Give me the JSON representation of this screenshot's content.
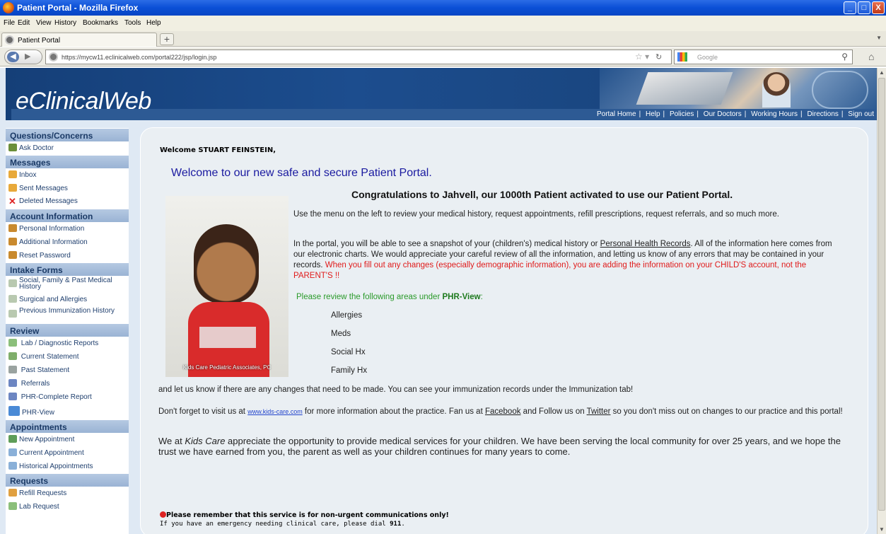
{
  "browser": {
    "title": "Patient Portal - Mozilla Firefox",
    "menu": [
      "File",
      "Edit",
      "View",
      "History",
      "Bookmarks",
      "Tools",
      "Help"
    ],
    "tab_title": "Patient Portal",
    "new_tab": "+",
    "url": "https://mycw11.eclinicalweb.com/portal222/jsp/login.jsp",
    "search_placeholder": "Google",
    "min": "_",
    "max": "□",
    "close": "X"
  },
  "header": {
    "logo": "eClinicalWeb",
    "nav": [
      "Portal Home",
      "Help",
      "Policies",
      "Our Doctors",
      "Working Hours",
      "Directions",
      "Sign out"
    ]
  },
  "sidebar": [
    {
      "heading": "Questions/Concerns",
      "items": [
        {
          "label": "Ask Doctor",
          "icon": "doctor-icon"
        }
      ]
    },
    {
      "heading": "Messages",
      "items": [
        {
          "label": "Inbox",
          "icon": "envelope-icon"
        },
        {
          "label": "Sent Messages",
          "icon": "envelope-icon"
        },
        {
          "label": "Deleted Messages",
          "icon": "delete-icon"
        }
      ]
    },
    {
      "heading": "Account Information",
      "items": [
        {
          "label": "Personal Information",
          "icon": "users-icon"
        },
        {
          "label": "Additional Information",
          "icon": "users-icon"
        },
        {
          "label": "Reset Password",
          "icon": "users-icon"
        }
      ]
    },
    {
      "heading": "Intake Forms",
      "items": [
        {
          "label": "Social, Family & Past Medical History",
          "icon": "folder-icon"
        },
        {
          "label": "Surgical and Allergies",
          "icon": "folder-icon"
        },
        {
          "label": "Previous Immunization History",
          "icon": "folder-icon"
        }
      ]
    },
    {
      "heading": "Review",
      "items": [
        {
          "label": "Lab / Diagnostic Reports",
          "icon": "lab-icon"
        },
        {
          "label": "Current Statement",
          "icon": "statement-icon"
        },
        {
          "label": "Past Statement",
          "icon": "statement-icon"
        },
        {
          "label": "Referrals",
          "icon": "referral-icon"
        },
        {
          "label": "PHR-Complete Report",
          "icon": "report-icon"
        },
        {
          "label": "PHR-View",
          "icon": "phr-view-icon"
        }
      ]
    },
    {
      "heading": "Appointments",
      "items": [
        {
          "label": "New Appointment",
          "icon": "calendar-icon"
        },
        {
          "label": "Current Appointment",
          "icon": "calendar-icon"
        },
        {
          "label": "Historical Appointments",
          "icon": "calendar-icon"
        }
      ]
    },
    {
      "heading": "Requests",
      "items": [
        {
          "label": "Refill Requests",
          "icon": "refill-icon"
        },
        {
          "label": "Lab Request",
          "icon": "lab-icon"
        }
      ]
    }
  ],
  "content": {
    "welcome": "Welcome STUART FEINSTEIN,",
    "headline": "Welcome to our new safe and secure Patient Portal.",
    "congrats": "Congratulations to Jahvell,  our 1000th Patient activated to use our Patient Portal.",
    "photo_caption": "Kids Care Pediatric Associates, PC",
    "para1": "Use the  menu on the left to review your medical history, request appointments, refill prescriptions, request referrals, and so much more.",
    "para2a": "In the portal, you will be able to see a snapshot of your (children's) medical history or ",
    "para2_link": "Personal Health Records",
    "para2b": ".  All of the information here comes from our electronic charts.  We would appreciate your careful review of all the information, and letting us know of any errors that may be contained in your records. ",
    "para2_red": "When you fill out any changes (especially demographic information), you are adding the information on your CHILD'S account,  not the PARENT'S !!",
    "review_intro": "Please review the following areas under ",
    "review_bold": "PHR-View",
    "review_colon": ":",
    "areas": [
      "Allergies",
      "Meds",
      "Social Hx",
      "Family Hx"
    ],
    "para3": "and let us know if there are any changes that need to be made.  You can see your immunization records under the Immunization tab!",
    "para4a": "Don't forget to visit us at ",
    "para4_link": "www.kids-care.com",
    "para4b": " for more information about the practice.   Fan us at ",
    "para4_fb": "Facebook",
    "para4c": " and Follow us on ",
    "para4_tw": "Twitter",
    "para4d": " so you don't miss out on changes to our practice and this portal!",
    "para5a": " We at ",
    "para5_kc": "Kids Care",
    "para5b": " appreciate the opportunity to provide medical services for your children. We have been serving the local community for over 25 years, and we hope the trust we have earned from you, the parent as well as your children continues for many years to come.",
    "notice": "Please remember that this service is for non-urgent communications only!",
    "emergency_a": "If you have an emergency needing clinical care, please dial ",
    "emergency_num": "911",
    "emergency_b": "."
  },
  "colors": {
    "header_blue": "#1c4d8e",
    "headline_blue": "#1a1aa0",
    "red_text": "#e01b1b",
    "green_text": "#2a9a2a"
  }
}
